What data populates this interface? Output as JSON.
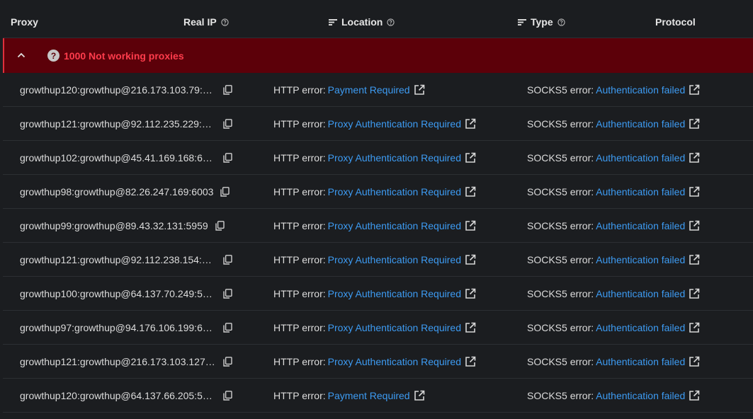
{
  "header": {
    "proxy": "Proxy",
    "real_ip": "Real IP",
    "location": "Location",
    "type": "Type",
    "protocol": "Protocol"
  },
  "group": {
    "label": "1000 Not working proxies",
    "icon": "question-circle-icon",
    "color": "#ff3c4c",
    "background": "#5c0009"
  },
  "rows": [
    {
      "proxy": "growthup120:growthup@216.173.103.79:6…",
      "http_prefix": "HTTP error:",
      "http_error": "Payment Required",
      "socks_prefix": "SOCKS5 error:",
      "socks_error": "Authentication failed"
    },
    {
      "proxy": "growthup121:growthup@92.112.235.229:6…",
      "http_prefix": "HTTP error:",
      "http_error": "Proxy Authentication Required",
      "socks_prefix": "SOCKS5 error:",
      "socks_error": "Authentication failed"
    },
    {
      "proxy": "growthup102:growthup@45.41.169.168:68…",
      "http_prefix": "HTTP error:",
      "http_error": "Proxy Authentication Required",
      "socks_prefix": "SOCKS5 error:",
      "socks_error": "Authentication failed"
    },
    {
      "proxy": "growthup98:growthup@82.26.247.169:6003",
      "http_prefix": "HTTP error:",
      "http_error": "Proxy Authentication Required",
      "socks_prefix": "SOCKS5 error:",
      "socks_error": "Authentication failed"
    },
    {
      "proxy": "growthup99:growthup@89.43.32.131:5959",
      "http_prefix": "HTTP error:",
      "http_error": "Proxy Authentication Required",
      "socks_prefix": "SOCKS5 error:",
      "socks_error": "Authentication failed"
    },
    {
      "proxy": "growthup121:growthup@92.112.238.154:7…",
      "http_prefix": "HTTP error:",
      "http_error": "Proxy Authentication Required",
      "socks_prefix": "SOCKS5 error:",
      "socks_error": "Authentication failed"
    },
    {
      "proxy": "growthup100:growthup@64.137.70.249:58…",
      "http_prefix": "HTTP error:",
      "http_error": "Proxy Authentication Required",
      "socks_prefix": "SOCKS5 error:",
      "socks_error": "Authentication failed"
    },
    {
      "proxy": "growthup97:growthup@94.176.106.199:66…",
      "http_prefix": "HTTP error:",
      "http_error": "Proxy Authentication Required",
      "socks_prefix": "SOCKS5 error:",
      "socks_error": "Authentication failed"
    },
    {
      "proxy": "growthup121:growthup@216.173.103.127:…",
      "http_prefix": "HTTP error:",
      "http_error": "Proxy Authentication Required",
      "socks_prefix": "SOCKS5 error:",
      "socks_error": "Authentication failed"
    },
    {
      "proxy": "growthup120:growthup@64.137.66.205:57…",
      "http_prefix": "HTTP error:",
      "http_error": "Payment Required",
      "socks_prefix": "SOCKS5 error:",
      "socks_error": "Authentication failed"
    }
  ],
  "colors": {
    "link": "#3d9bf2",
    "background": "#1b1d20",
    "divider": "#2c2f33"
  }
}
